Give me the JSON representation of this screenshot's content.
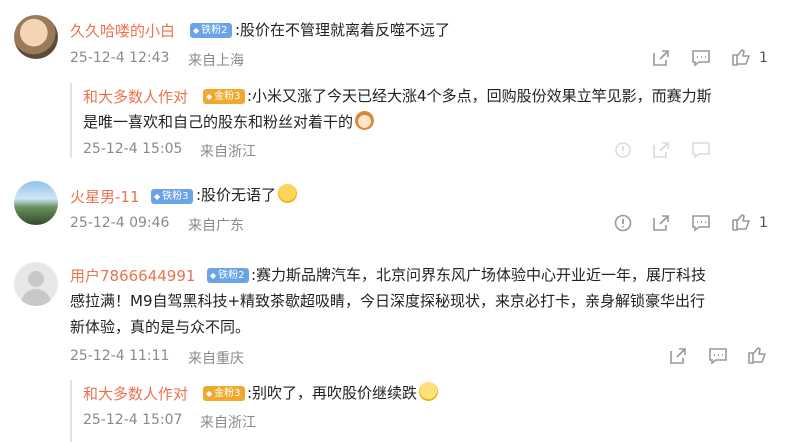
{
  "comments": [
    {
      "username": "久久哈喽的小白",
      "badge": "铁粉2",
      "text": ":股价在不管理就离着反噬不远了",
      "time": "25-12-4 12:43",
      "location": "来自上海",
      "like_count": "1",
      "replies": [
        {
          "username": "和大多数人作对",
          "badge": "金粉3",
          "text_line1": ":小米又涨了今天已经大涨4个多点，回购股份效果立竿见影，而赛力斯",
          "text_line2": "是唯一喜欢和自己的股东和粉丝对着干的",
          "time": "25-12-4 15:05",
          "location": "来自浙江"
        }
      ]
    },
    {
      "username": "火星男-11",
      "badge": "铁粉3",
      "text": ":股价无语了",
      "time": "25-12-4 09:46",
      "location": "来自广东",
      "like_count": "1"
    },
    {
      "username": "用户7866644991",
      "badge": "铁粉2",
      "text_line1": ":赛力斯品牌汽车，北京问界东风广场体验中心开业近一年，展厅科技",
      "text_line2": "感拉满！M9自驾黑科技+精致茶歇超吸睛，今日深度探秘现状，来京必打卡，亲身解锁豪华出行",
      "text_line3": "新体验，真的是与众不同。",
      "time": "25-12-4 11:11",
      "location": "来自重庆",
      "replies": [
        {
          "username": "和大多数人作对",
          "badge": "金粉3",
          "text": ":别吹了，再吹股价继续跌",
          "time": "25-12-4 15:07",
          "location": "来自浙江"
        }
      ]
    }
  ],
  "icons": {
    "share": "share-icon",
    "comment": "comment-icon",
    "like": "like-icon",
    "report": "report-icon"
  },
  "colors": {
    "username": "#eb7350",
    "meta": "#8a8a8a",
    "iron_badge": "#6aa4e6",
    "gold_badge": "#f0a92e"
  }
}
